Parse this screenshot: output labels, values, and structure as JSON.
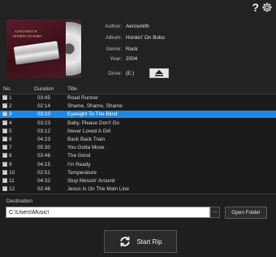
{
  "album": {
    "cover_text_line1": "AEROSMITH",
    "cover_text_line2": "HONKIN' ON BOBO",
    "author_label": "Author:",
    "author": "Aerosmith",
    "album_label": "Album:",
    "album": "Honkin' On Bobo",
    "genre_label": "Genre:",
    "genre": "Rock",
    "year_label": "Year:",
    "year": "2004",
    "drive_label": "Drive:",
    "drive": "(E:)"
  },
  "icons": {
    "help": "?",
    "settings": "gear-icon",
    "eject": "eject-icon",
    "rip": "refresh-icon"
  },
  "table": {
    "columns": [
      "No.",
      "Duration",
      "Title"
    ],
    "selected_index": 2,
    "rows": [
      {
        "no": "1",
        "duration": "03:45",
        "title": "Road Runner"
      },
      {
        "no": "2",
        "duration": "02:14",
        "title": "Shame, Shame, Shame"
      },
      {
        "no": "3",
        "duration": "03:10",
        "title": "Eyesight To The Blind"
      },
      {
        "no": "4",
        "duration": "03:23",
        "title": "Baby, Please Don't Go"
      },
      {
        "no": "5",
        "duration": "03:12",
        "title": "Never Loved A Girl"
      },
      {
        "no": "6",
        "duration": "04:23",
        "title": "Back Back Train"
      },
      {
        "no": "7",
        "duration": "05:30",
        "title": "You Gotta Move"
      },
      {
        "no": "8",
        "duration": "03:46",
        "title": "The Grind"
      },
      {
        "no": "9",
        "duration": "04:15",
        "title": "I'm Ready"
      },
      {
        "no": "10",
        "duration": "02:51",
        "title": "Temperature"
      },
      {
        "no": "11",
        "duration": "04:32",
        "title": "Stop Messin' Around"
      },
      {
        "no": "12",
        "duration": "02:48",
        "title": "Jesus Is On The Main Line"
      }
    ]
  },
  "destination": {
    "label": "Destination",
    "path": "C:\\Users\\Music\\",
    "browse_label": "...",
    "open_folder_label": "Open Folder"
  },
  "rip_button": {
    "label": "Start Rip"
  },
  "colors": {
    "selection": "#1e88e5",
    "background": "#1e1e1e"
  }
}
